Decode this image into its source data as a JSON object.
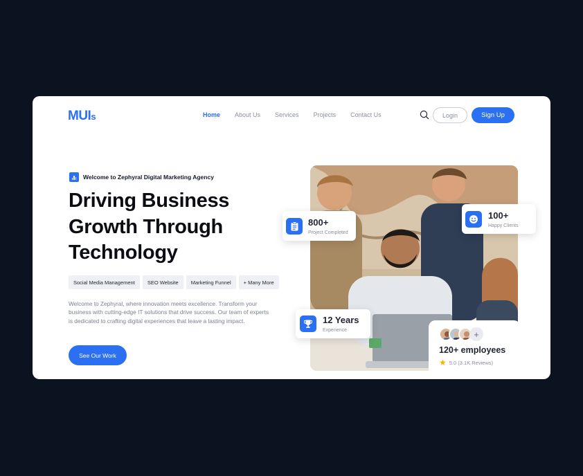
{
  "header": {
    "logo_main": "MUI",
    "logo_suffix": "s",
    "nav": [
      "Home",
      "About Us",
      "Services",
      "Projects",
      "Contact Us"
    ],
    "active_nav": "Home",
    "login_label": "Login",
    "signup_label": "Sign Up"
  },
  "hero": {
    "welcome": "Welcome to Zephyral Digital Marketing Agency",
    "headline_line1": "Driving Business",
    "headline_line2": "Growth Through",
    "headline_line3": "Technology",
    "tags": [
      "Social Media Management",
      "SEO Website",
      "Marketing Funnel",
      "+ Many More"
    ],
    "description": "Welcome to Zephyral, where innovation meets excellence. Transform your business with cutting-edge IT solutions that drive success. Our team of experts is dedicated to crafting digital experiences that leave a lasting impact.",
    "cta_label": "See Our Work"
  },
  "stats": {
    "projects": {
      "value": "800+",
      "label": "Project Completed"
    },
    "clients": {
      "value": "100+",
      "label": "Happy Clients"
    },
    "experience": {
      "value": "12 Years",
      "label": "Experience"
    },
    "employees": {
      "value": "120+ employees",
      "rating": "5.0 (3.1K Reviews)",
      "plus": "+"
    }
  },
  "colors": {
    "accent": "#2b6ff2",
    "background": "#0b1220",
    "star": "#f5b301"
  },
  "icons": [
    "search-icon",
    "chart-icon",
    "clipboard-icon",
    "smiley-icon",
    "trophy-icon",
    "star-icon"
  ]
}
